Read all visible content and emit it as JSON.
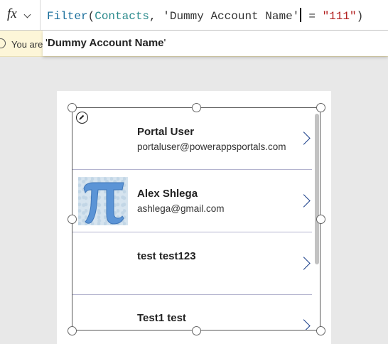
{
  "formula_bar": {
    "fx_label": "fx",
    "tokens": {
      "fn": "Filter",
      "open_paren": "(",
      "source": "Contacts",
      "comma": ", ",
      "column": "'Dummy Account Name'",
      "operator": " = ",
      "value": "\"111\"",
      "close_paren": ")"
    }
  },
  "warning": {
    "text": "You are"
  },
  "suggestion": {
    "quote_open": "'",
    "name": "Dummy Account Name",
    "quote_close": "'"
  },
  "gallery": {
    "items": [
      {
        "title": "Portal User",
        "subtitle": "portaluser@powerappsportals.com",
        "has_image": false
      },
      {
        "title": "Alex Shlega",
        "subtitle": "ashlega@gmail.com",
        "has_image": true
      },
      {
        "title": "test test123",
        "subtitle": "",
        "has_image": false
      },
      {
        "title": "Test1 test",
        "subtitle": "",
        "has_image": false
      }
    ]
  },
  "icons": {
    "fx": "function-icon",
    "chevron_down": "chevron-down-icon",
    "warning": "info-circle-icon",
    "edit": "pencil-icon",
    "row_nav": "chevron-right-icon",
    "avatar_image": "pi-symbol-image"
  },
  "colors": {
    "function_token": "#1b6f9c",
    "identifier_token": "#2a8a8c",
    "string_token": "#b21e1e",
    "warning_background": "#fdf6d8",
    "row_divider": "#b4b4cf",
    "chevron": "#1b3f8b",
    "pi_symbol": "#5b94d6"
  }
}
